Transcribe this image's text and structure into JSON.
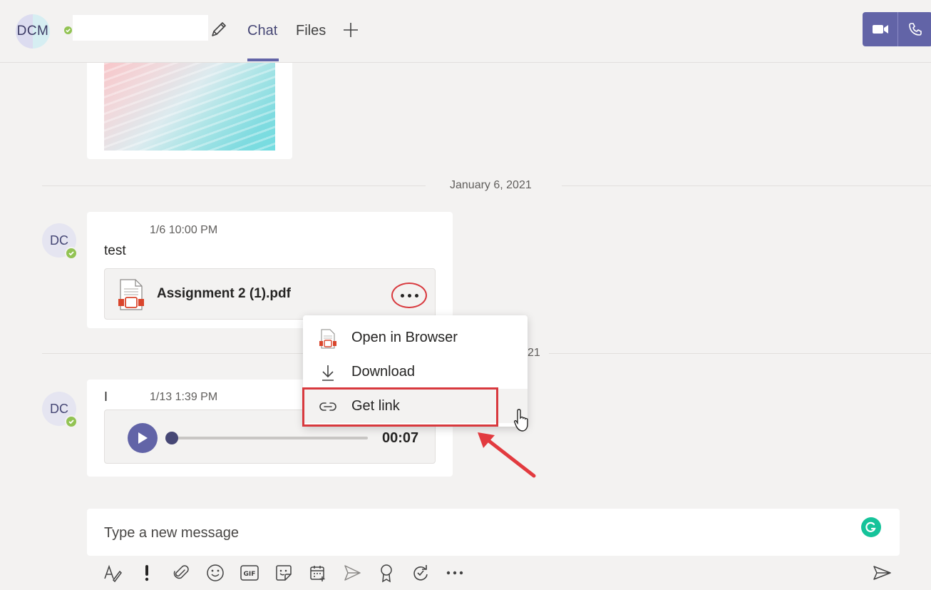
{
  "header": {
    "avatar_initials": "DCM",
    "tabs": [
      {
        "label": "Chat",
        "active": true
      },
      {
        "label": "Files",
        "active": false
      }
    ],
    "add_tab_icon": "plus-icon",
    "video_call_icon": "video-camera-icon",
    "audio_call_icon": "phone-icon",
    "accent_color": "#6264a7"
  },
  "messages": [
    {
      "avatar_initials": "DC",
      "timestamp": "1/6 10:00 PM",
      "text": "test",
      "attachment": {
        "file_name": "Assignment 2 (1).pdf",
        "file_icon": "pdf-file-icon"
      }
    },
    {
      "avatar_initials": "DC",
      "timestamp": "1/13 1:39 PM",
      "text": "I",
      "voice_clip": {
        "duration": "00:07"
      }
    }
  ],
  "dates": {
    "first": "January 6, 2021",
    "second_partial": "21"
  },
  "context_menu": {
    "items": [
      {
        "label": "Open in Browser",
        "icon": "pdf-file-icon"
      },
      {
        "label": "Download",
        "icon": "download-icon"
      },
      {
        "label": "Get link",
        "icon": "link-icon",
        "highlighted": true
      }
    ]
  },
  "compose": {
    "placeholder": "Type a new message"
  },
  "toolbar": {
    "icons": [
      "format-icon",
      "important-icon",
      "attach-icon",
      "emoji-icon",
      "gif-icon",
      "sticker-icon",
      "schedule-meeting-icon",
      "stream-icon",
      "praise-icon",
      "loop-icon",
      "more-options-icon",
      "send-icon"
    ]
  }
}
